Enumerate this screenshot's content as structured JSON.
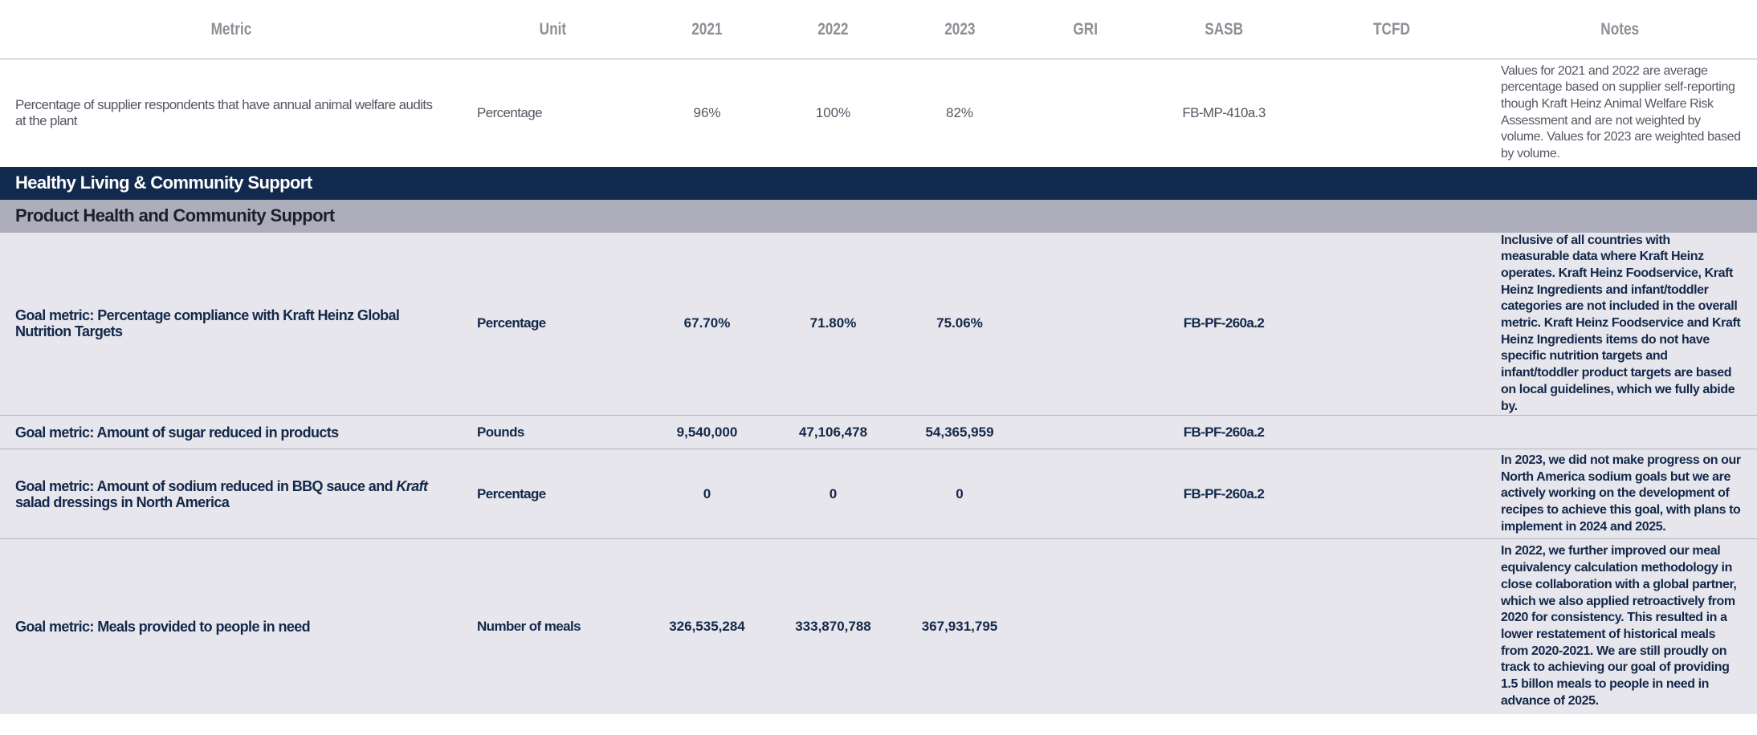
{
  "header": {
    "metric": "Metric",
    "unit": "Unit",
    "y2021": "2021",
    "y2022": "2022",
    "y2023": "2023",
    "gri": "GRI",
    "sasb": "SASB",
    "tcfd": "TCFD",
    "notes": "Notes"
  },
  "animal_row": {
    "metric": "Percentage of supplier respondents that have annual animal welfare audits at the plant",
    "unit": "Percentage",
    "y2021": "96%",
    "y2022": "100%",
    "y2023": "82%",
    "gri": "",
    "sasb": "FB-MP-410a.3",
    "tcfd": "",
    "notes": "Values for 2021 and 2022 are average percentage based on supplier self-reporting though Kraft Heinz Animal Welfare Risk Assessment and are not weighted by volume. Values for 2023 are weighted based by volume."
  },
  "section_title": "Healthy Living & Community Support",
  "subsection_title": "Product Health and Community Support",
  "rows": [
    {
      "metric": "Goal metric: Percentage compliance with Kraft Heinz Global Nutrition Targets",
      "unit": "Percentage",
      "y2021": "67.70%",
      "y2022": "71.80%",
      "y2023": "75.06%",
      "gri": "",
      "sasb": "FB-PF-260a.2",
      "tcfd": "",
      "notes": "Inclusive of all countries with measurable data where Kraft Heinz operates. Kraft Heinz Foodservice, Kraft Heinz Ingredients and infant/toddler categories are not included in the overall metric. Kraft Heinz Foodservice and Kraft Heinz Ingredients items do not have specific nutrition targets and infant/toddler product targets are based on local guidelines, which we fully abide by."
    },
    {
      "metric": "Goal metric: Amount of sugar reduced in products",
      "unit": "Pounds",
      "y2021": "9,540,000",
      "y2022": "47,106,478",
      "y2023": "54,365,959",
      "gri": "",
      "sasb": "FB-PF-260a.2",
      "tcfd": "",
      "notes": ""
    },
    {
      "metric_a": "Goal metric: Amount of sodium reduced in BBQ sauce and ",
      "metric_brand": "Kraft",
      "metric_b": " salad dressings in North America",
      "unit": "Percentage",
      "y2021": "0",
      "y2022": "0",
      "y2023": "0",
      "gri": "",
      "sasb": "FB-PF-260a.2",
      "tcfd": "",
      "notes": "In 2023, we did not make progress on our North America sodium goals but we are actively working on the development of recipes to achieve this goal, with plans to implement in 2024 and 2025."
    },
    {
      "metric": "Goal metric: Meals provided to people in need",
      "unit": "Number of meals",
      "y2021": "326,535,284",
      "y2022": "333,870,788",
      "y2023": "367,931,795",
      "gri": "",
      "sasb": "",
      "tcfd": "",
      "notes": "In 2022, we further improved our meal equivalency calculation methodology in close collaboration with a global partner, which we also applied retroactively from 2020 for consistency. This resulted in a lower restatement of historical meals from 2020-2021. We are still proudly on track to achieving our goal of providing 1.5 billon meals to people in need in advance of 2025."
    }
  ],
  "colors": {
    "section_bg": "#132a4f",
    "subsection_bg": "#adadbb",
    "goal_row_bg": "#e6e6ec",
    "goal_text": "#13284a",
    "header_text": "#8d8f96"
  }
}
